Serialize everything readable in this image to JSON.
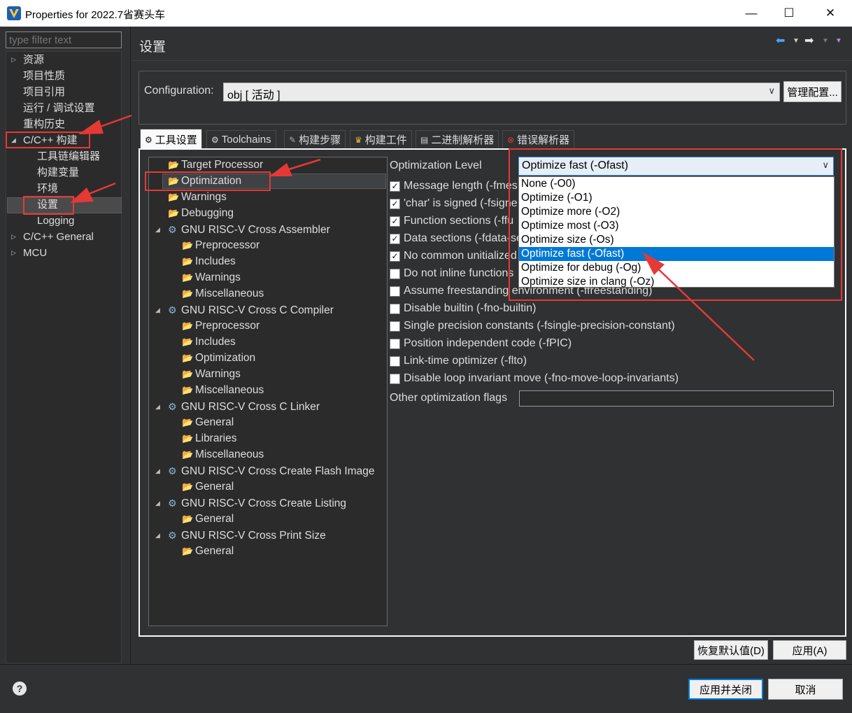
{
  "window": {
    "title": "Properties for 2022.7省赛头车",
    "minimize": "—",
    "maximize": "☐",
    "close": "✕"
  },
  "filter": {
    "placeholder": "type filter text"
  },
  "nav": [
    {
      "label": "资源"
    },
    {
      "label": "项目性质"
    },
    {
      "label": "项目引用"
    },
    {
      "label": "运行 / 调试设置"
    },
    {
      "label": "重构历史"
    },
    {
      "label": "C/C++ 构建"
    },
    {
      "label": "工具链编辑器"
    },
    {
      "label": "构建变量"
    },
    {
      "label": "环境"
    },
    {
      "label": "设置"
    },
    {
      "label": "Logging"
    },
    {
      "label": "C/C++ General"
    },
    {
      "label": "MCU"
    }
  ],
  "header": {
    "title": "设置"
  },
  "config": {
    "label": "Configuration:",
    "value": "obj  [ 活动 ]",
    "manage_button": "管理配置..."
  },
  "tabs": [
    {
      "label": "工具设置",
      "icon": "tool-settings-icon"
    },
    {
      "label": "Toolchains",
      "icon": "toolchains-icon"
    },
    {
      "label": "构建步骤",
      "icon": "build-steps-icon"
    },
    {
      "label": "构建工件",
      "icon": "build-artifact-icon"
    },
    {
      "label": "二进制解析器",
      "icon": "binary-parser-icon"
    },
    {
      "label": "错误解析器",
      "icon": "error-parser-icon"
    }
  ],
  "tree": [
    {
      "label": "Target Processor"
    },
    {
      "label": "Optimization"
    },
    {
      "label": "Warnings"
    },
    {
      "label": "Debugging"
    },
    {
      "label": "GNU RISC-V Cross Assembler"
    },
    {
      "label": "Preprocessor"
    },
    {
      "label": "Includes"
    },
    {
      "label": "Warnings"
    },
    {
      "label": "Miscellaneous"
    },
    {
      "label": "GNU RISC-V Cross C Compiler"
    },
    {
      "label": "Preprocessor"
    },
    {
      "label": "Includes"
    },
    {
      "label": "Optimization"
    },
    {
      "label": "Warnings"
    },
    {
      "label": "Miscellaneous"
    },
    {
      "label": "GNU RISC-V Cross C Linker"
    },
    {
      "label": "General"
    },
    {
      "label": "Libraries"
    },
    {
      "label": "Miscellaneous"
    },
    {
      "label": "GNU RISC-V Cross Create Flash Image"
    },
    {
      "label": "General"
    },
    {
      "label": "GNU RISC-V Cross Create Listing"
    },
    {
      "label": "General"
    },
    {
      "label": "GNU RISC-V Cross Print Size"
    },
    {
      "label": "General"
    }
  ],
  "optimization": {
    "level_label": "Optimization Level",
    "level_value": "Optimize fast (-Ofast)",
    "dropdown_options": [
      "None (-O0)",
      "Optimize (-O1)",
      "Optimize more (-O2)",
      "Optimize most (-O3)",
      "Optimize size (-Os)",
      "Optimize fast (-Ofast)",
      "Optimize for debug (-Og)",
      "Optimize size in clang (-Oz)"
    ],
    "highlighted_option_index": 5,
    "options": [
      {
        "label": "Message length (-fmes",
        "checked": true
      },
      {
        "label": "'char' is signed (-fsigne",
        "checked": true
      },
      {
        "label": "Function sections (-ffu",
        "checked": true
      },
      {
        "label": "Data sections (-fdata-se",
        "checked": true
      },
      {
        "label": "No common unitialized",
        "checked": true
      },
      {
        "label": "Do not inline functions",
        "checked": false
      },
      {
        "label": "Assume freestanding environment (-ffreestanding)",
        "checked": false
      },
      {
        "label": "Disable builtin (-fno-builtin)",
        "checked": false
      },
      {
        "label": "Single precision constants (-fsingle-precision-constant)",
        "checked": false
      },
      {
        "label": "Position independent code (-fPIC)",
        "checked": false
      },
      {
        "label": "Link-time optimizer (-flto)",
        "checked": false
      },
      {
        "label": "Disable loop invariant move (-fno-move-loop-invariants)",
        "checked": false
      }
    ],
    "other_flags_label": "Other optimization flags",
    "other_flags_value": ""
  },
  "buttons": {
    "restore_defaults": "恢复默认值(D)",
    "apply": "应用(A)",
    "apply_close": "应用并关闭",
    "cancel": "取消"
  },
  "colors": {
    "accent": "#0078d7",
    "annotation_red": "#e53935"
  }
}
